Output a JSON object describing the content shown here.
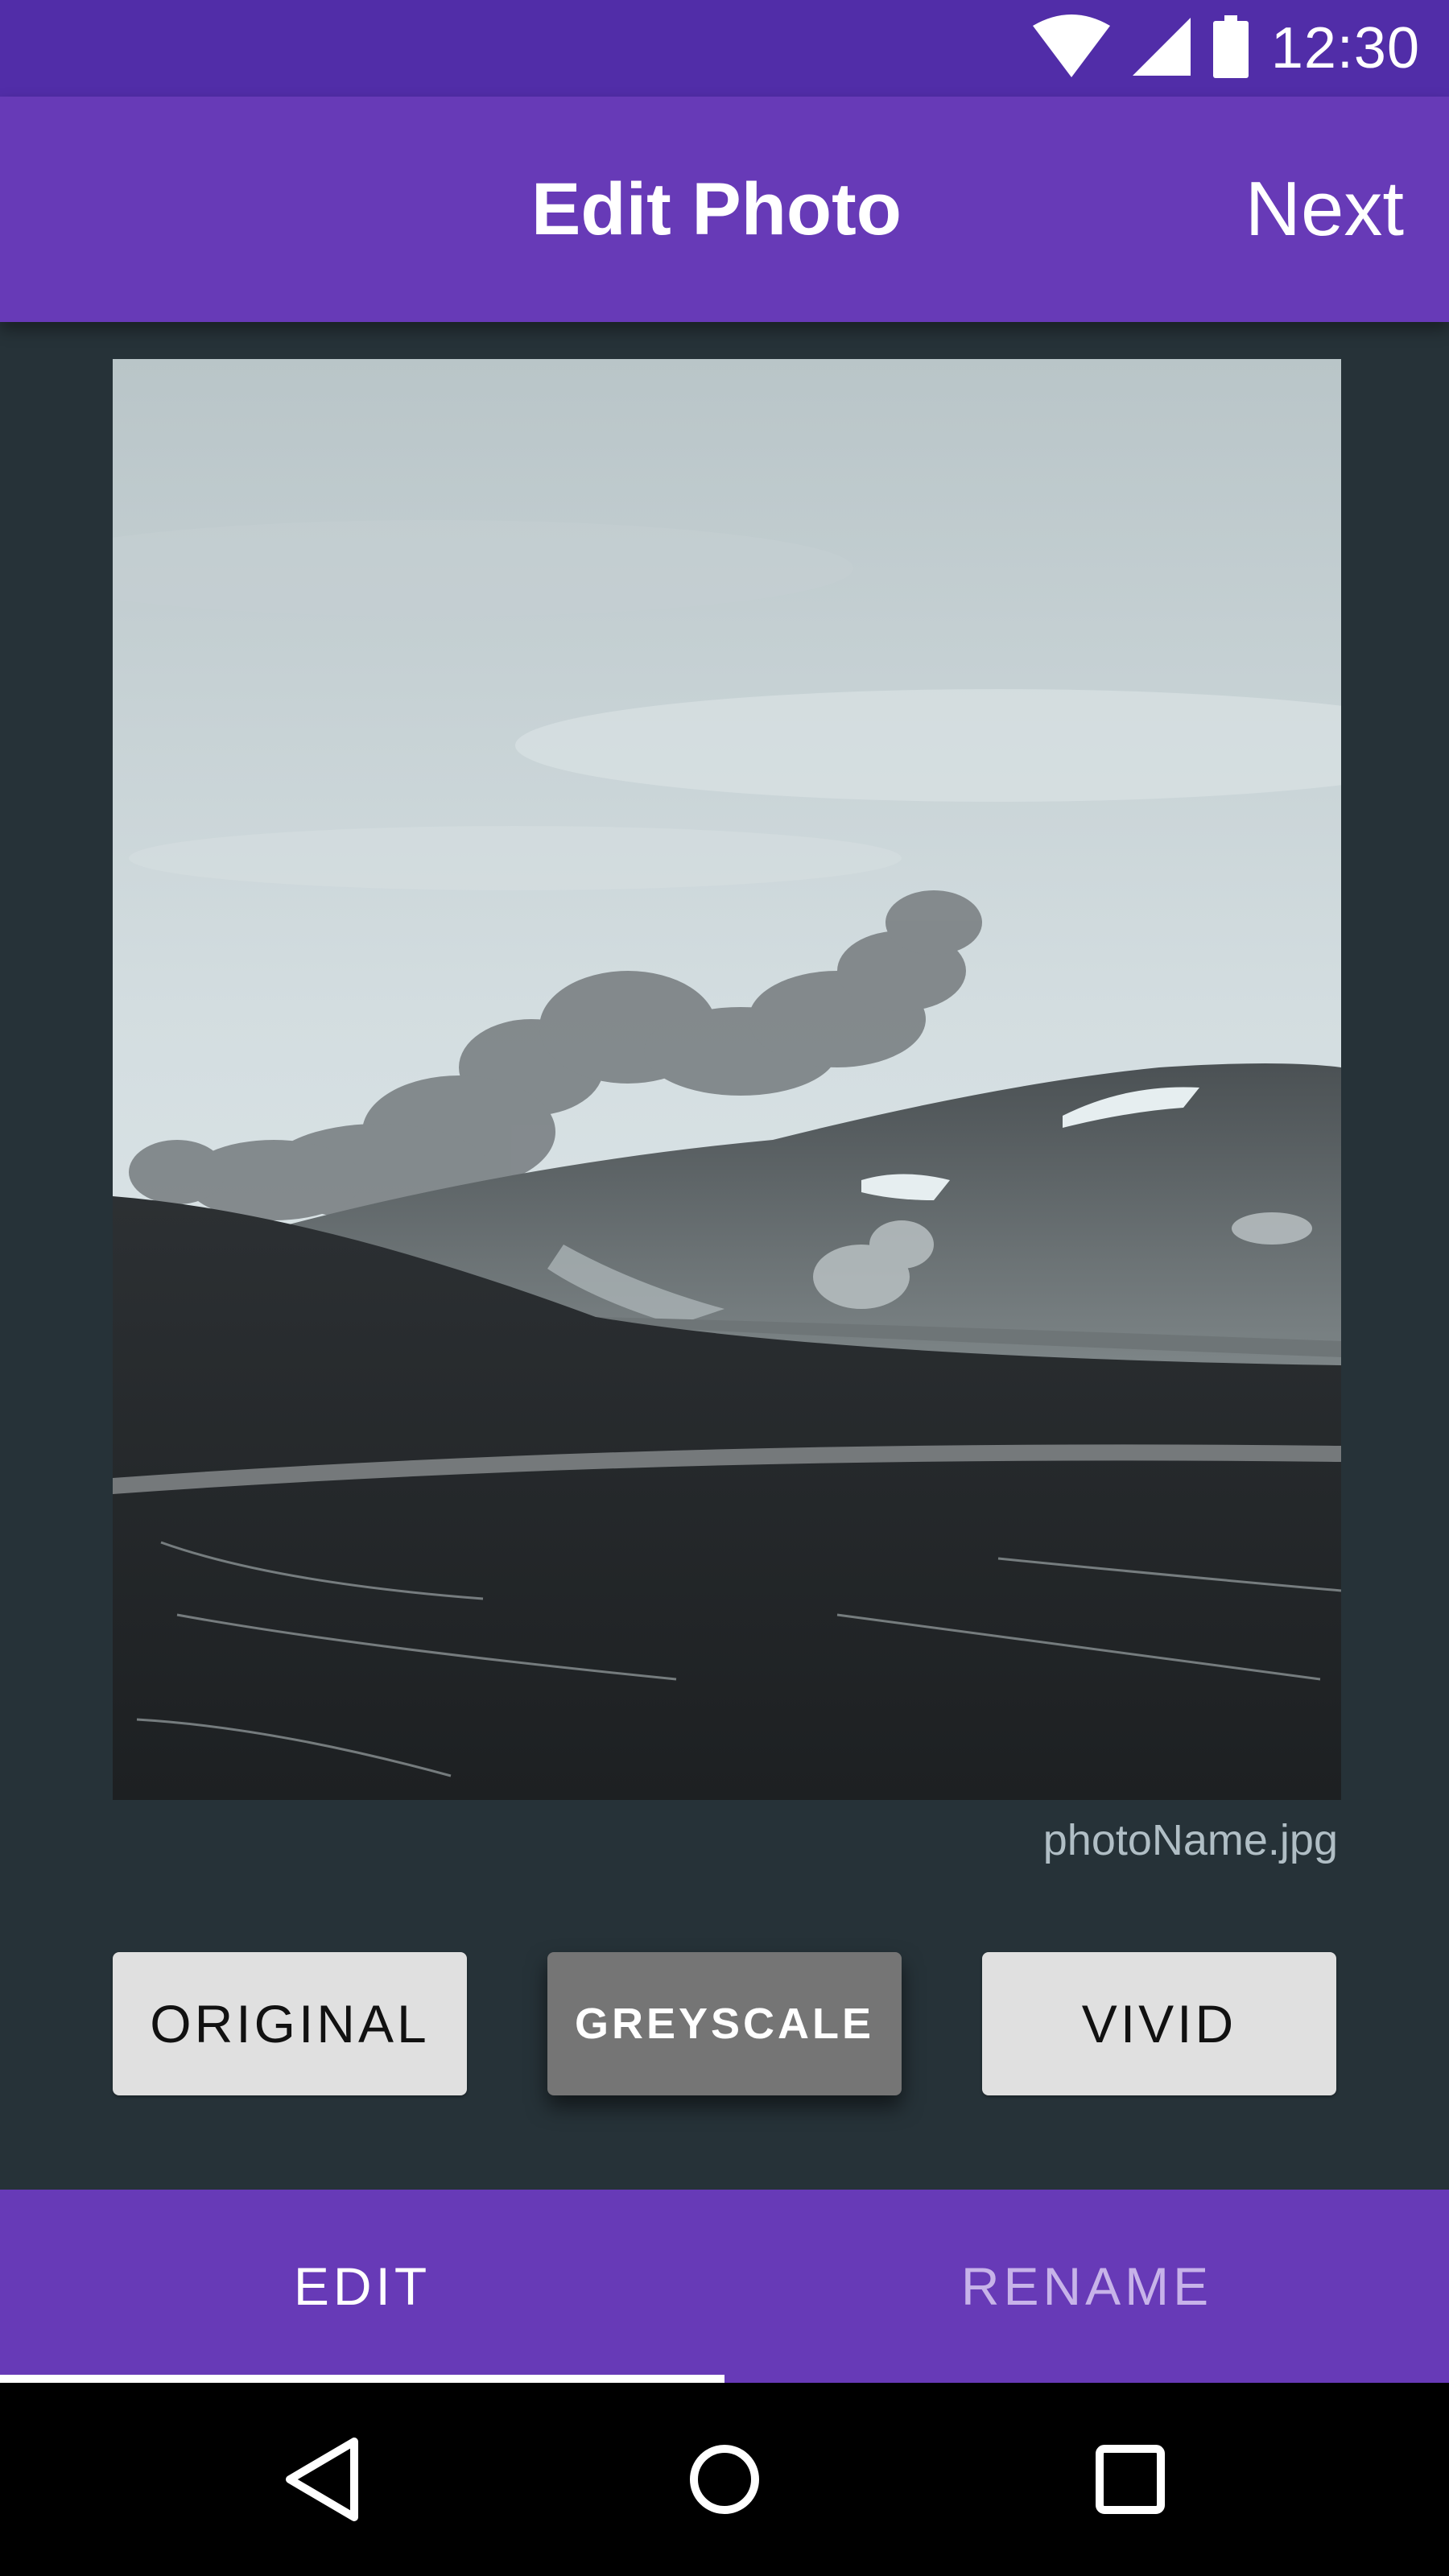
{
  "status_bar": {
    "time": "12:30",
    "icons": [
      "wifi-icon",
      "cell-signal-icon",
      "battery-icon"
    ]
  },
  "app_bar": {
    "title": "Edit Photo",
    "action_label": "Next"
  },
  "photo": {
    "icon": "photo-image",
    "filename": "photoName.jpg"
  },
  "filters": [
    {
      "label": "ORIGINAL",
      "selected": false
    },
    {
      "label": "GREYSCALE",
      "selected": true
    },
    {
      "label": "VIVID",
      "selected": false
    }
  ],
  "tabs": [
    {
      "label": "EDIT",
      "selected": true
    },
    {
      "label": "RENAME",
      "selected": false
    }
  ],
  "nav_bar": {
    "icons": [
      "back-icon",
      "home-icon",
      "recents-icon"
    ]
  },
  "colors": {
    "status_bar": "#512DA8",
    "primary": "#673AB7",
    "background": "#263238",
    "button": "#E0E0E0",
    "button_active": "#757575"
  }
}
